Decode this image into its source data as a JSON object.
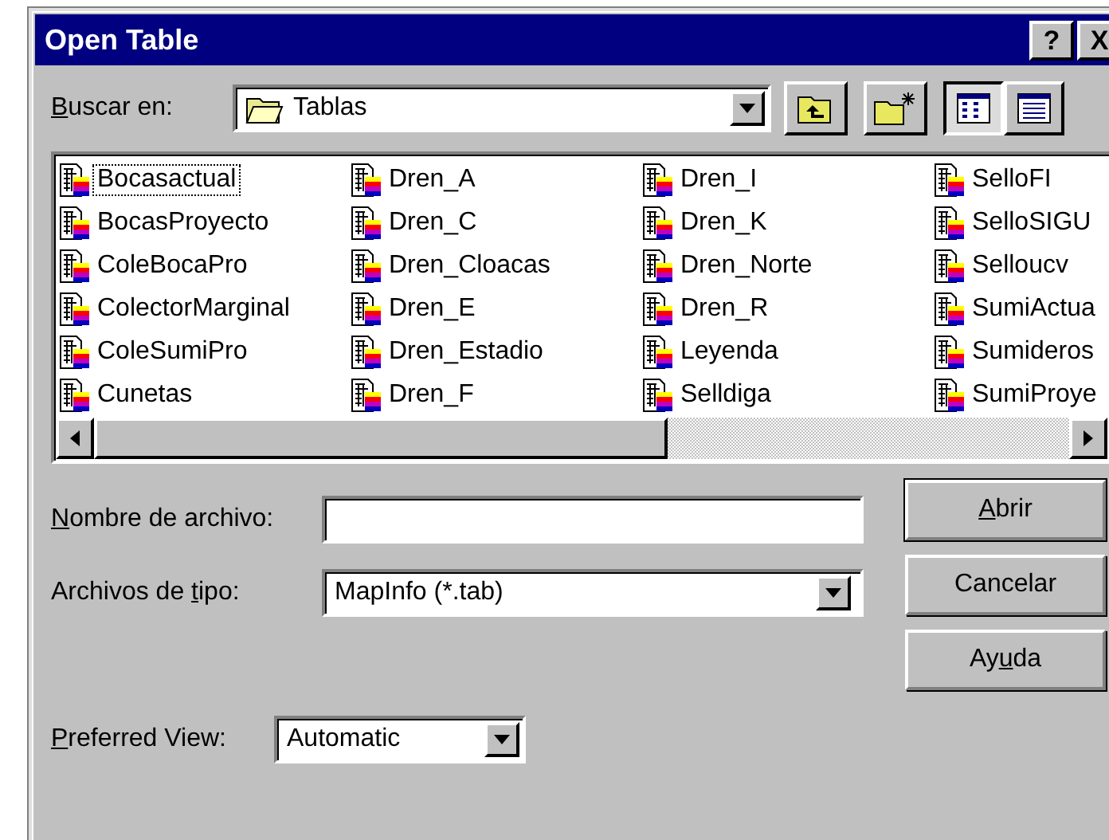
{
  "window": {
    "title": "Open Table",
    "title_buttons": [
      "?",
      "X"
    ]
  },
  "look_in": {
    "label": {
      "key": "B",
      "post": "uscar en:"
    },
    "value": "Tablas"
  },
  "files": [
    {
      "name": "Bocasactual",
      "selected": true
    },
    {
      "name": "BocasProyecto",
      "selected": false
    },
    {
      "name": "ColeBocaPro",
      "selected": false
    },
    {
      "name": "ColectorMarginal",
      "selected": false
    },
    {
      "name": "ColeSumiPro",
      "selected": false
    },
    {
      "name": "Cunetas",
      "selected": false
    },
    {
      "name": "Dren_A",
      "selected": false
    },
    {
      "name": "Dren_C",
      "selected": false
    },
    {
      "name": "Dren_Cloacas",
      "selected": false
    },
    {
      "name": "Dren_E",
      "selected": false
    },
    {
      "name": "Dren_Estadio",
      "selected": false
    },
    {
      "name": "Dren_F",
      "selected": false
    },
    {
      "name": "Dren_I",
      "selected": false
    },
    {
      "name": "Dren_K",
      "selected": false
    },
    {
      "name": "Dren_Norte",
      "selected": false
    },
    {
      "name": "Dren_R",
      "selected": false
    },
    {
      "name": "Leyenda",
      "selected": false
    },
    {
      "name": "Selldiga",
      "selected": false
    },
    {
      "name": "SelloFI",
      "selected": false
    },
    {
      "name": "SelloSIGU",
      "selected": false
    },
    {
      "name": "Selloucv",
      "selected": false
    },
    {
      "name": "SumiActua",
      "selected": false
    },
    {
      "name": "Sumideros",
      "selected": false
    },
    {
      "name": "SumiProye",
      "selected": false
    }
  ],
  "file_name": {
    "label": {
      "key": "N",
      "post": "ombre de archivo:"
    }
  },
  "file_type": {
    "label": {
      "pre": "Archivos de ",
      "key": "t",
      "post": "ipo:"
    },
    "value": "MapInfo (*.tab)"
  },
  "preferred_view": {
    "label": {
      "key": "P",
      "post": "referred View:"
    },
    "value": "Automatic"
  },
  "buttons": [
    {
      "label": {
        "key": "A",
        "post": "brir"
      },
      "default": true
    },
    {
      "label": {
        "pre": "Cancelar"
      },
      "default": false
    },
    {
      "label": {
        "pre": "Ay",
        "key": "u",
        "post": "da"
      },
      "default": false
    }
  ]
}
